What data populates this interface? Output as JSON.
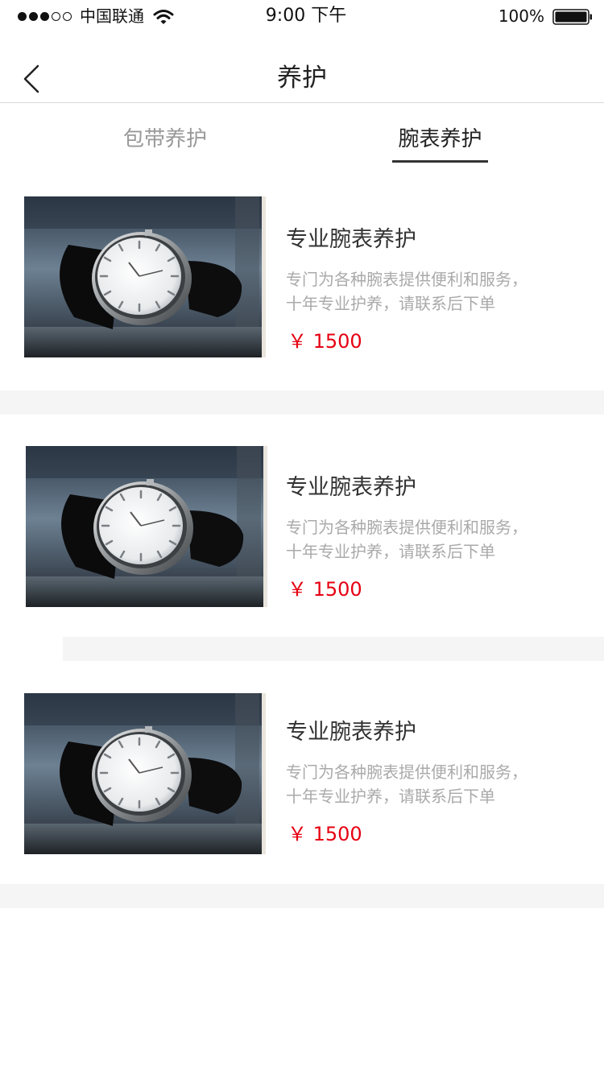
{
  "status_bar": {
    "carrier": "中国联通",
    "time": "9:00 下午",
    "battery": "100%"
  },
  "nav": {
    "title": "养护"
  },
  "tabs": [
    {
      "label": "包带养护",
      "active": false
    },
    {
      "label": "腕表养护",
      "active": true
    }
  ],
  "items": [
    {
      "title": "专业腕表养护",
      "desc_line1": "专门为各种腕表提供便利和服务，",
      "desc_line2": "十年专业护养，请联系后下单",
      "price": "￥ 1500"
    },
    {
      "title": "专业腕表养护",
      "desc_line1": "专门为各种腕表提供便利和服务，",
      "desc_line2": "十年专业护养，请联系后下单",
      "price": "￥ 1500"
    },
    {
      "title": "专业腕表养护",
      "desc_line1": "专门为各种腕表提供便利和服务，",
      "desc_line2": "十年专业护养，请联系后下单",
      "price": "￥ 1500"
    }
  ],
  "colors": {
    "price": "#e60012",
    "divider": "#f5f5f5",
    "tab_active": "#222222",
    "tab_inactive": "#999999"
  }
}
